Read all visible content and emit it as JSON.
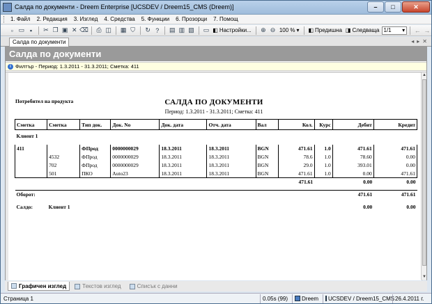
{
  "window": {
    "title": "Салда по документи - Dreem Enterprise  [UCSDEV / Dreem15_CMS (Dreem)]"
  },
  "menu": [
    "1. Файл",
    "2. Редакция",
    "3. Изглед",
    "4. Средства",
    "5. Функции",
    "6. Прозорци",
    "7. Помощ"
  ],
  "toolbar": {
    "settings_label": "Настройки...",
    "zoom_value": "100 %",
    "prev_label": "Предишна",
    "next_label": "Следваща",
    "page_value": "1/1"
  },
  "tab": {
    "label": "Салда по документи"
  },
  "header": {
    "title": "Салда по документи"
  },
  "filter": {
    "text": "Филтър - Период: 1.3.2011 - 31.3.2011; Сметка: 411"
  },
  "report": {
    "consumer": "Потребител на продукта",
    "title": "САЛДА ПО ДОКУМЕНТИ",
    "subtitle": "Период: 1.3.2011 - 31.3.2011; Сметка: 411",
    "columns": [
      "Сметка",
      "Сметка",
      "Тип док.",
      "Док. No",
      "Док. дата",
      "Отч. дата",
      "Вал",
      "Кол.",
      "Курс",
      "Дебит",
      "Кредит"
    ],
    "group": "Клиент 1",
    "rows": [
      [
        "411",
        "",
        "ФПрод",
        "0000000029",
        "18.3.2011",
        "18.3.2011",
        "BGN",
        "471.61",
        "1.0",
        "471.61",
        "471.61"
      ],
      [
        "",
        "4532",
        "ФПрод",
        "0000000029",
        "18.3.2011",
        "18.3.2011",
        "BGN",
        "78.6",
        "1.0",
        "78.60",
        "0.00"
      ],
      [
        "",
        "702",
        "ФПрод",
        "0000000029",
        "18.3.2011",
        "18.3.2011",
        "BGN",
        "29.0",
        "1.0",
        "393.01",
        "0.00"
      ],
      [
        "",
        "501",
        "ПКО",
        "Auto23",
        "18.3.2011",
        "18.3.2011",
        "BGN",
        "471.61",
        "1.0",
        "0.00",
        "471.61"
      ]
    ],
    "subtotal": {
      "kol": "471.61",
      "debit": "0.00",
      "credit": "0.00"
    },
    "turnover": {
      "label": "Оборот:",
      "debit": "471.61",
      "credit": "471.61"
    },
    "balance": {
      "label": "Салдо:",
      "client": "Клиент 1",
      "debit": "0.00",
      "credit": "0.00"
    }
  },
  "bottom_tabs": [
    "Графичен изглед",
    "Текстов изглед",
    "Списък с данни"
  ],
  "status": {
    "page": "Страница 1",
    "time": "0.05s (99)",
    "user": "Dreem",
    "db": "UCSDEV / Dreem15_CMS",
    "date": "26.4.2011 г."
  }
}
